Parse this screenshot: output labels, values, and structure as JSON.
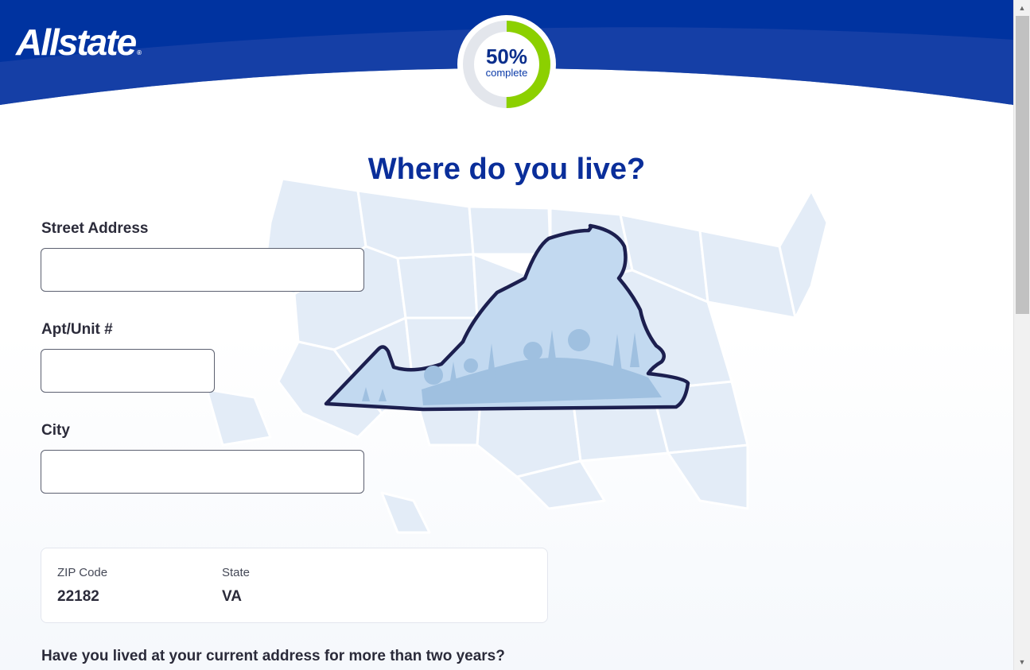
{
  "brand": {
    "name": "Allstate",
    "registered_mark": "®"
  },
  "progress": {
    "percent_label": "50%",
    "caption": "complete",
    "value": 0.5
  },
  "page_title": "Where do you live?",
  "fields": {
    "street": {
      "label": "Street Address",
      "value": ""
    },
    "apt": {
      "label": "Apt/Unit #",
      "value": ""
    },
    "city": {
      "label": "City",
      "value": ""
    }
  },
  "location": {
    "zip_label": "ZIP Code",
    "zip_value": "22182",
    "state_label": "State",
    "state_value": "VA"
  },
  "question": "Have you lived at your current address for more than two years?",
  "colors": {
    "brand_blue": "#0033a0",
    "progress_green": "#8cd000",
    "title_blue": "#0a2e9a",
    "map_fill": "#e3ecf7",
    "state_outline": "#1c1f4f"
  },
  "icons": {
    "scroll_up": "scroll-up-arrow-icon",
    "scroll_down": "scroll-down-arrow-icon"
  }
}
